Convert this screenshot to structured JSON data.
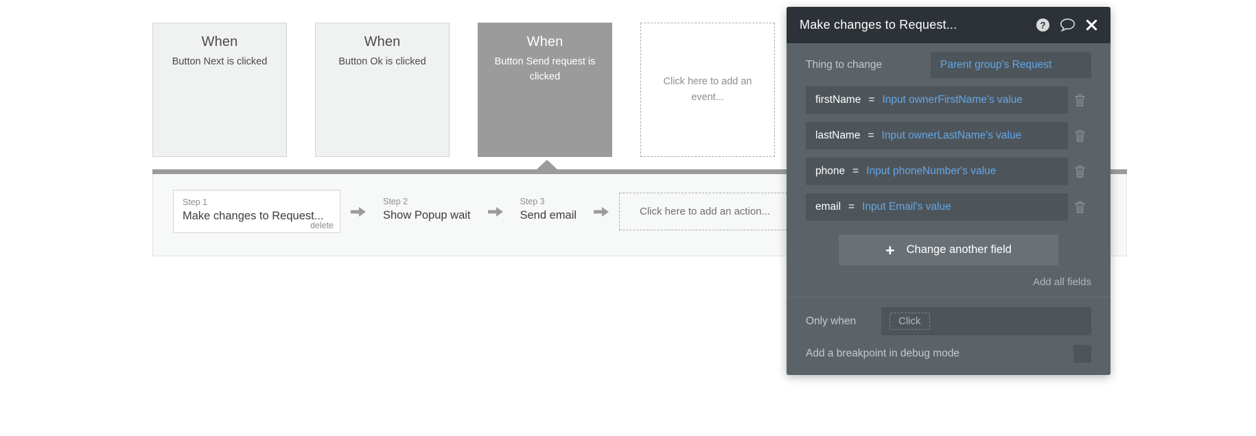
{
  "workflow": {
    "events": [
      {
        "title": "When",
        "description": "Button Next is clicked",
        "selected": false,
        "placeholder": false
      },
      {
        "title": "When",
        "description": "Button Ok is clicked",
        "selected": false,
        "placeholder": false
      },
      {
        "title": "When",
        "description": "Button Send request is clicked",
        "selected": true,
        "placeholder": false
      },
      {
        "title": "",
        "description": "",
        "placeholder": true,
        "placeholder_text": "Click here to add an event..."
      }
    ],
    "actions": [
      {
        "step_label": "Step 1",
        "name": "Make changes to Request...",
        "delete_label": "delete"
      },
      {
        "step_label": "Step 2",
        "name": "Show Popup wait",
        "delete_label": ""
      },
      {
        "step_label": "Step 3",
        "name": "Send email",
        "delete_label": ""
      }
    ],
    "add_action_text": "Click here to add an action..."
  },
  "panel": {
    "title": "Make changes to Request...",
    "icons": {
      "help": "help-icon",
      "comment": "comment-icon",
      "close": "close-icon"
    },
    "thing_to_change": {
      "label": "Thing to change",
      "value": "Parent group's Request"
    },
    "fields": [
      {
        "key": "firstName",
        "eq": "=",
        "value": "Input ownerFirstName's value"
      },
      {
        "key": "lastName",
        "eq": "=",
        "value": "Input ownerLastName's value"
      },
      {
        "key": "phone",
        "eq": "=",
        "value": "Input phoneNumber's value"
      },
      {
        "key": "email",
        "eq": "=",
        "value": "Input Email's value"
      }
    ],
    "change_another_field_label": "Change another field",
    "change_another_field_plus": "+",
    "add_all_fields_label": "Add all fields",
    "only_when": {
      "label": "Only when",
      "placeholder": "Click"
    },
    "breakpoint": {
      "label": "Add a breakpoint in debug mode",
      "checked": false
    }
  },
  "colors": {
    "panel_header_bg": "#2c3237",
    "panel_bg": "#5c6368",
    "field_bg": "#4e555a",
    "accent_blue": "#63a7e8",
    "selected_event_bg": "#9b9b9b",
    "divider": "#9b9b9b"
  }
}
